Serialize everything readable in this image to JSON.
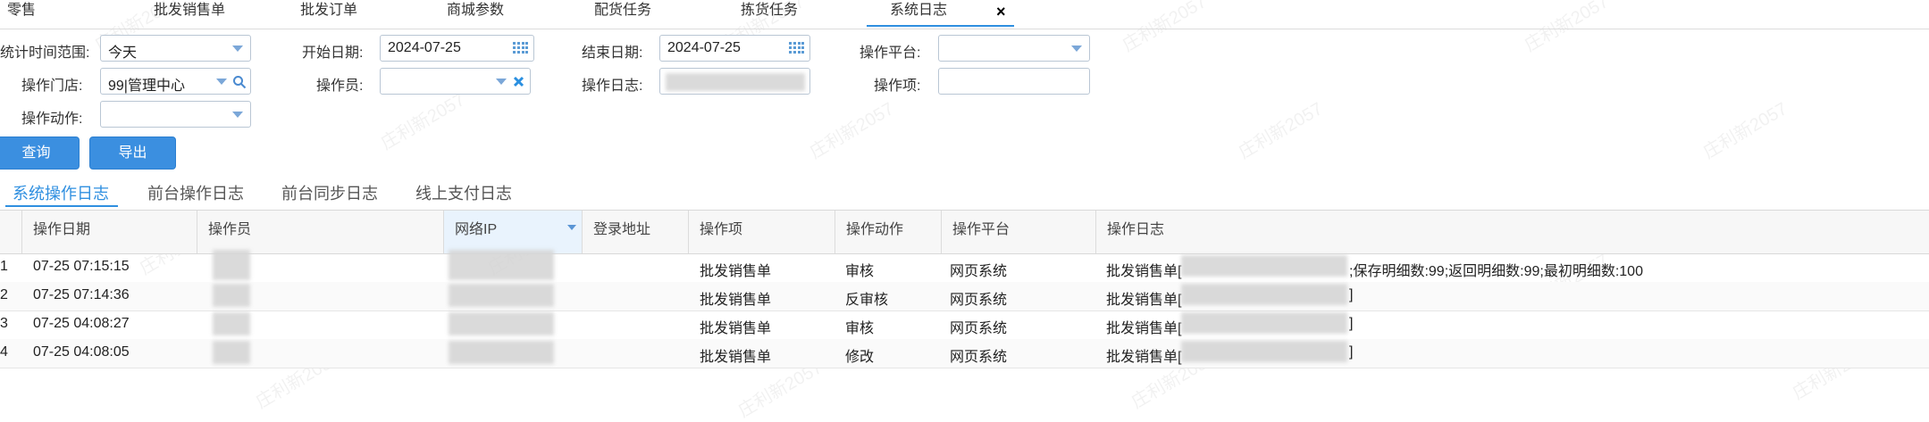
{
  "tabs": [
    {
      "label": "零售"
    },
    {
      "label": "批发销售单"
    },
    {
      "label": "批发订单"
    },
    {
      "label": "商城参数"
    },
    {
      "label": "配货任务"
    },
    {
      "label": "拣货任务"
    },
    {
      "label": "系统日志",
      "active": true
    }
  ],
  "filters": {
    "time_range_label": "统计时间范围:",
    "time_range_value": "今天",
    "start_date_label": "开始日期:",
    "start_date_value": "2024-07-25",
    "end_date_label": "结束日期:",
    "end_date_value": "2024-07-25",
    "platform_label": "操作平台:",
    "platform_value": "",
    "store_label": "操作门店:",
    "store_value": "99|管理中心",
    "operator_label": "操作员:",
    "operator_value": "",
    "log_label": "操作日志:",
    "log_value": "",
    "item_label": "操作项:",
    "item_value": "",
    "action_label": "操作动作:",
    "action_value": ""
  },
  "buttons": {
    "query": "查询",
    "export": "导出"
  },
  "subtabs": [
    {
      "label": "系统操作日志",
      "active": true
    },
    {
      "label": "前台操作日志"
    },
    {
      "label": "前台同步日志"
    },
    {
      "label": "线上支付日志"
    }
  ],
  "table": {
    "columns": [
      "操作日期",
      "操作员",
      "网络IP",
      "登录地址",
      "操作项",
      "操作动作",
      "操作平台",
      "操作日志"
    ],
    "rows": [
      {
        "num": "1",
        "date": "07-25 07:15:15",
        "item": "批发销售单",
        "action": "审核",
        "platform": "网页系统",
        "log_prefix": "批发销售单[",
        "log_suffix": ";保存明细数:99;返回明细数:99;最初明细数:100"
      },
      {
        "num": "2",
        "date": "07-25 07:14:36",
        "item": "批发销售单",
        "action": "反审核",
        "platform": "网页系统",
        "log_prefix": "批发销售单[",
        "log_suffix": "]"
      },
      {
        "num": "3",
        "date": "07-25 04:08:27",
        "item": "批发销售单",
        "action": "审核",
        "platform": "网页系统",
        "log_prefix": "批发销售单[",
        "log_suffix": "]"
      },
      {
        "num": "4",
        "date": "07-25 04:08:05",
        "item": "批发销售单",
        "action": "修改",
        "platform": "网页系统",
        "log_prefix": "批发销售单[",
        "log_suffix": "]"
      }
    ]
  },
  "watermark": "庄利新2057",
  "colors": {
    "accent": "#2f8fe0",
    "button": "#3b8fe0"
  }
}
